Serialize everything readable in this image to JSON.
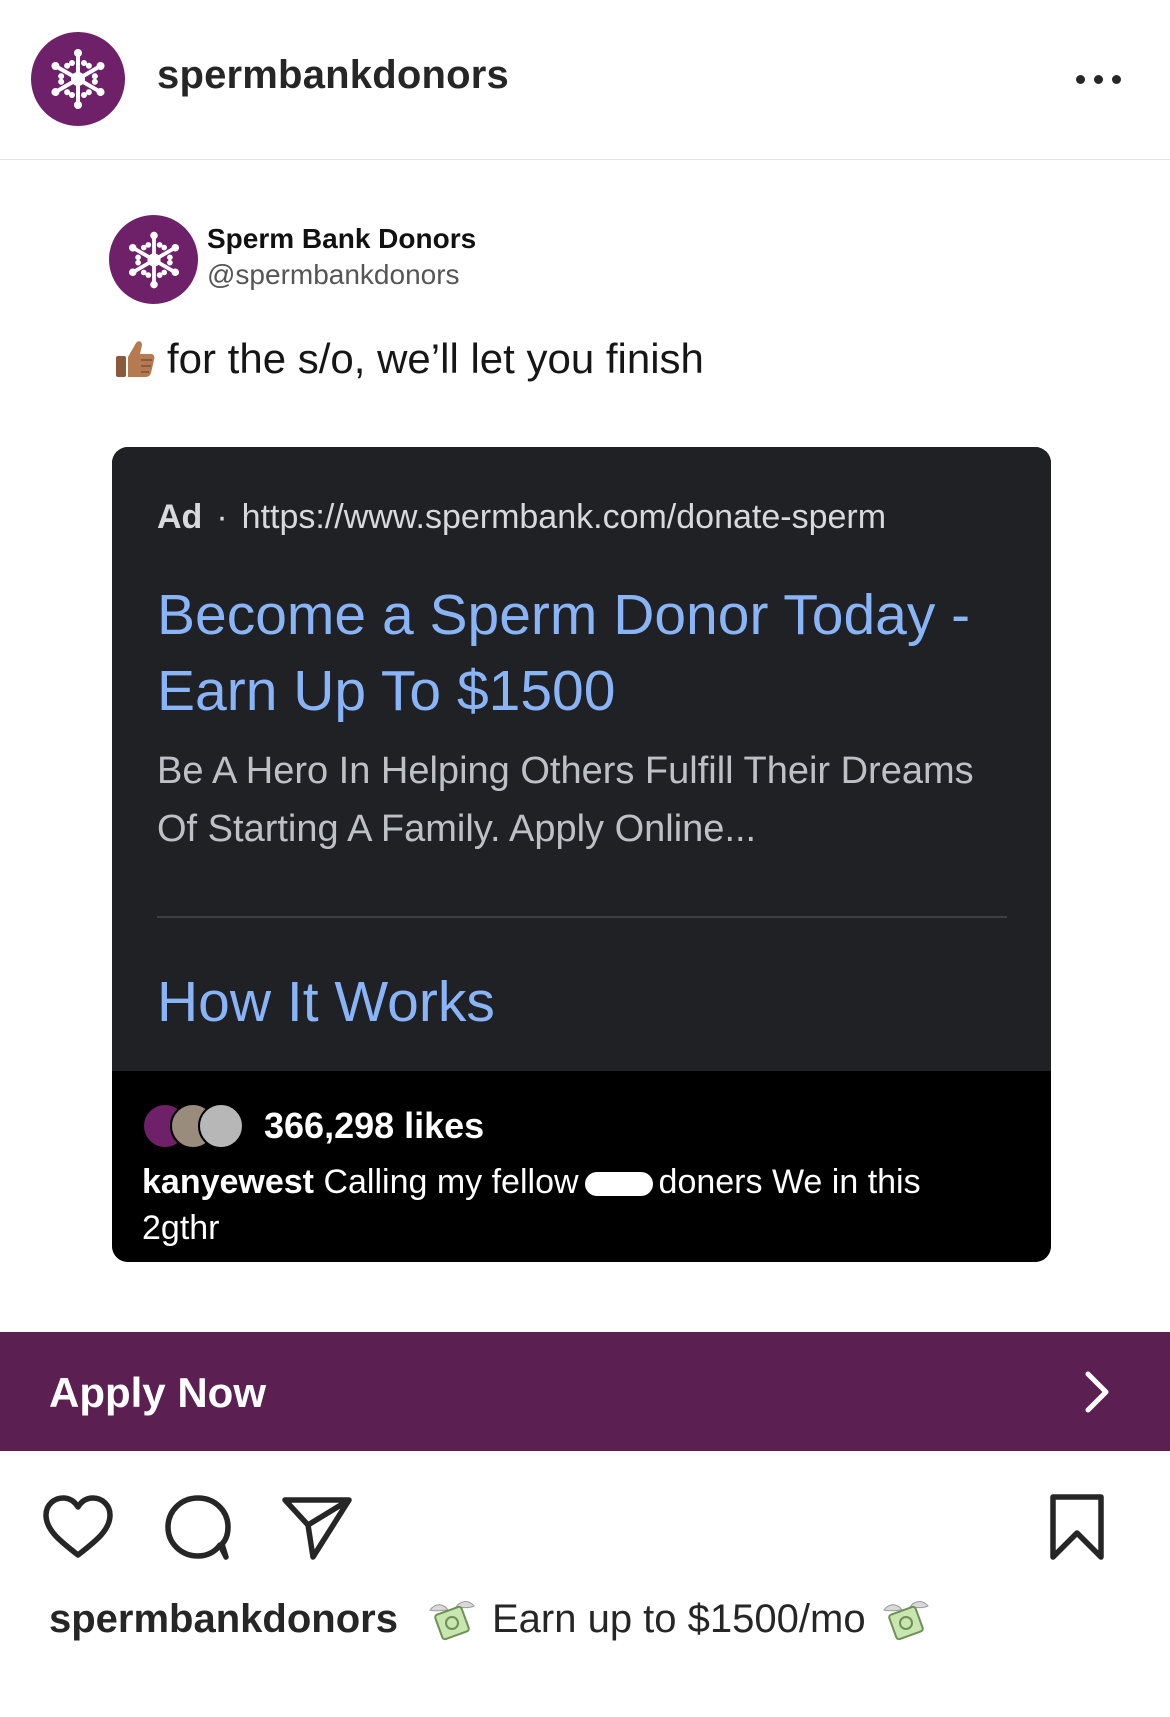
{
  "header": {
    "username": "spermbankdonors",
    "avatar_icon": "snowflake-logo-icon",
    "more_icon": "more-options-icon"
  },
  "tweet": {
    "name": "Sperm Bank Donors",
    "handle": "@spermbankdonors",
    "emoji_icon": "thumbs-up-icon",
    "text": "for the s/o, we’ll let you finish",
    "ad": {
      "label": "Ad",
      "separator": "·",
      "url": "https://www.spermbank.com/donate-sperm",
      "title": "Become a Sperm Donor Today - Earn Up To $1500",
      "description": "Be A Hero In Helping Others Fulfill Their Dreams Of Starting A Family. Apply Online...",
      "sitelink": "How It Works"
    },
    "ig": {
      "likes": "366,298 likes",
      "comment_user": "kanyewest",
      "comment_before": "Calling my fellow",
      "comment_after": "doners  We in this 2gthr"
    }
  },
  "cta": {
    "label": "Apply Now",
    "icon": "chevron-right-icon"
  },
  "actions": {
    "like_icon": "heart-icon",
    "comment_icon": "comment-icon",
    "share_icon": "send-icon",
    "save_icon": "bookmark-icon"
  },
  "caption": {
    "username": "spermbankdonors",
    "text": "Earn up to $1500/mo",
    "emoji_icon": "money-with-wings-icon"
  },
  "colors": {
    "brand_purple": "#6e2068",
    "cta_purple": "#5c1f52",
    "ad_background": "#202124",
    "ad_link_blue": "#8ab4f8"
  }
}
